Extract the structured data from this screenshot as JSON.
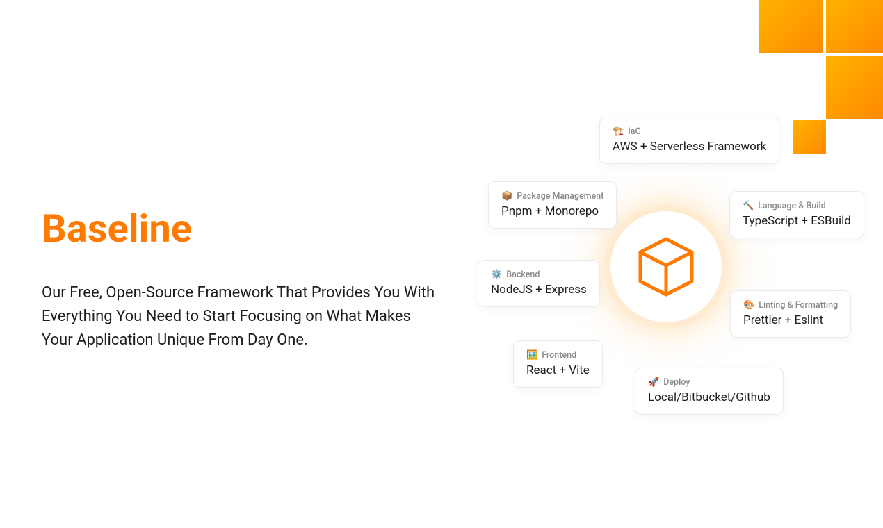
{
  "hero": {
    "title": "Baseline",
    "subtitle": "Our Free, Open-Source Framework That Provides You With Everything You Need to Start Focusing on What Makes Your Application Unique From Day One."
  },
  "cards": {
    "iac": {
      "emoji": "🏗️",
      "label": "IaC",
      "value": "AWS + Serverless Framework"
    },
    "pkg": {
      "emoji": "📦",
      "label": "Package Management",
      "value": "Pnpm + Monorepo"
    },
    "lang": {
      "emoji": "🔨",
      "label": "Language & Build",
      "value": "TypeScript + ESBuild"
    },
    "backend": {
      "emoji": "⚙️",
      "label": "Backend",
      "value": "NodeJS + Express"
    },
    "lint": {
      "emoji": "🎨",
      "label": "Linting & Formatting",
      "value": "Prettier + Eslint"
    },
    "front": {
      "emoji": "🖼️",
      "label": "Frontend",
      "value": "React + Vite"
    },
    "deploy": {
      "emoji": "🚀",
      "label": "Deploy",
      "value": "Local/Bitbucket/Github"
    }
  },
  "colors": {
    "accent": "#ff7a00"
  }
}
